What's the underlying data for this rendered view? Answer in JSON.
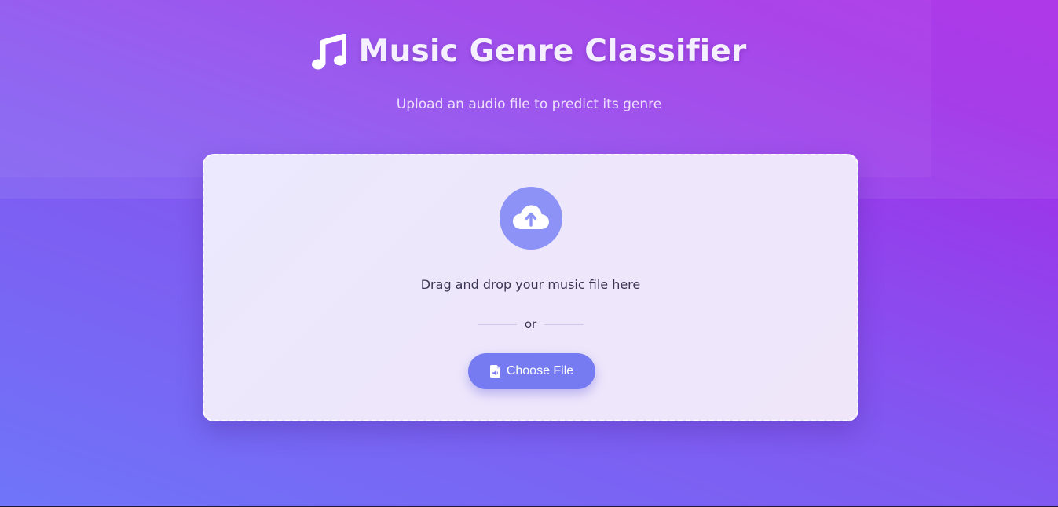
{
  "header": {
    "title": "Music Genre Classifier",
    "subtitle": "Upload an audio file to predict its genre",
    "title_icon": "music-note-icon"
  },
  "upload": {
    "icon": "cloud-upload-icon",
    "drop_text": "Drag and drop your music file here",
    "or_text": "or",
    "button_label": "Choose File",
    "button_icon": "audio-file-icon"
  },
  "colors": {
    "background_start": "#6f75f8",
    "background_end": "#a92ae8",
    "card_background": "#ece8fd",
    "accent": "#767bf2",
    "upload_circle": "#8c92f6"
  }
}
